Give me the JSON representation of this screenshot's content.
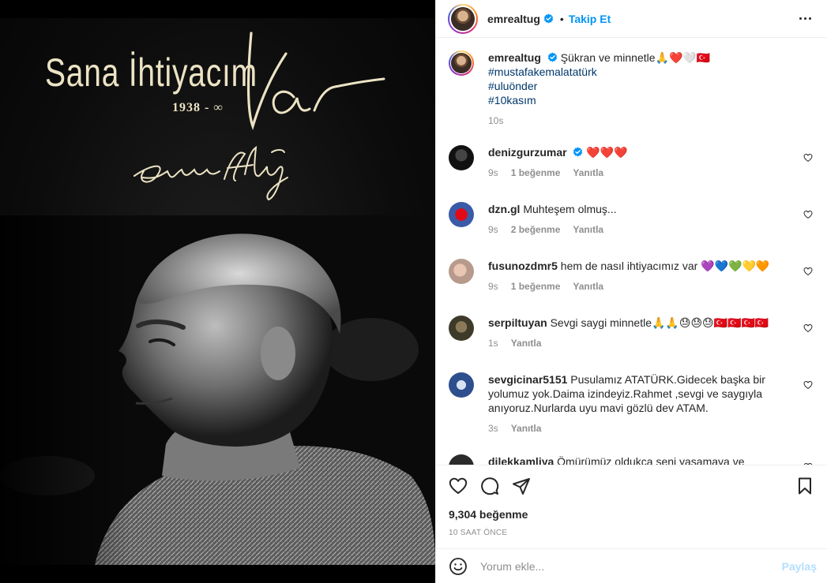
{
  "poster": {
    "title": "Sana İhtiyacım",
    "years": "1938 - ∞"
  },
  "header": {
    "username": "emrealtug",
    "separator": "•",
    "follow_label": "Takip Et"
  },
  "caption": {
    "username": "emrealtug",
    "text": "Şükran ve minnetle🙏❤️🤍🇹🇷",
    "hashtags": [
      "#mustafakemalatatürk",
      "#uluönder",
      "#10kasım"
    ],
    "time": "10s"
  },
  "comments": [
    {
      "username": "denizgurzumar",
      "verified": true,
      "text": "❤️❤️❤️",
      "time": "9s",
      "likes": "1 beğenme",
      "reply": "Yanıtla"
    },
    {
      "username": "dzn.gl",
      "verified": false,
      "text": "Muhteşem olmuş...",
      "time": "9s",
      "likes": "2 beğenme",
      "reply": "Yanıtla"
    },
    {
      "username": "fusunozdmr5",
      "verified": false,
      "text": "hem de nasıl ihtiyacımız var 💜💙💚💛🧡",
      "time": "9s",
      "likes": "1 beğenme",
      "reply": "Yanıtla"
    },
    {
      "username": "serpiltuyan",
      "verified": false,
      "text": "Sevgi saygi minnetle🙏🙏😓😓😓🇹🇷🇹🇷🇹🇷🇹🇷",
      "time": "1s",
      "likes": "",
      "reply": "Yanıtla"
    },
    {
      "username": "sevgicinar5151",
      "verified": false,
      "text": "Pusulamız ATATÜRK.Gidecek başka bir yolumuz yok.Daima izindeyiz.Rahmet ,sevgi ve saygıyla anıyoruz.Nurlarda uyu mavi gözlü dev ATAM.",
      "time": "3s",
      "likes": "",
      "reply": "Yanıtla"
    },
    {
      "username": "dilekkamliya",
      "verified": false,
      "text": "Ömürümüz oldukça seni yaşamaya ve",
      "time": "",
      "likes": "",
      "reply": ""
    }
  ],
  "stats": {
    "likes": "9,304 beğenme",
    "posted": "10 SAAT ÖNCE"
  },
  "add_comment": {
    "placeholder": "Yorum ekle...",
    "share_label": "Paylaş"
  },
  "colors": {
    "accent": "#0095f6",
    "link": "#00376b",
    "muted": "#8e8e8e",
    "share_disabled": "#b2dffc",
    "poster_text": "#ece3c4"
  },
  "icons": [
    "verified-badge-icon",
    "more-options-icon",
    "heart-icon",
    "comment-icon",
    "share-icon",
    "bookmark-icon",
    "emoji-icon"
  ]
}
